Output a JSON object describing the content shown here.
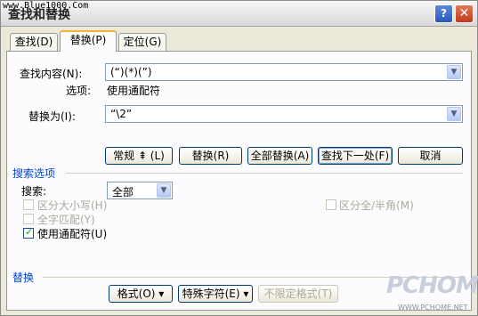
{
  "window": {
    "title": "查找和替换",
    "watermark_top": "www.Blue1000.Com",
    "help_label": "?",
    "close_label": "✕"
  },
  "tabs": [
    {
      "label": "查找(D)",
      "active": false
    },
    {
      "label": "替换(P)",
      "active": true
    },
    {
      "label": "定位(G)",
      "active": false
    }
  ],
  "find": {
    "label": "查找内容(N):",
    "value": "(“)(*)(”)",
    "options_label": "选项:",
    "options_value": "使用通配符"
  },
  "replace": {
    "label": "替换为(I):",
    "value": "“\\2”"
  },
  "buttons": {
    "normal": "常规 ⇞ (L)",
    "replace": "替换(R)",
    "replace_all": "全部替换(A)",
    "find_next": "查找下一处(F)",
    "cancel": "取消"
  },
  "search_options": {
    "section_label": "搜索选项",
    "search_label": "搜索:",
    "search_value": "全部",
    "match_case": "区分大小写(H)",
    "whole_word": "全字匹配(Y)",
    "use_wildcards": "使用通配符(U)",
    "half_full_width": "区分全/半角(M)"
  },
  "replace_section": {
    "section_label": "替换",
    "format_button": "格式(O) ▾",
    "special_button": "特殊字符(E) ▾",
    "no_format_button": "不限定格式(T)"
  },
  "watermark": {
    "brand": "PCHOME",
    "url": "WWW.PCHOME.NET"
  }
}
